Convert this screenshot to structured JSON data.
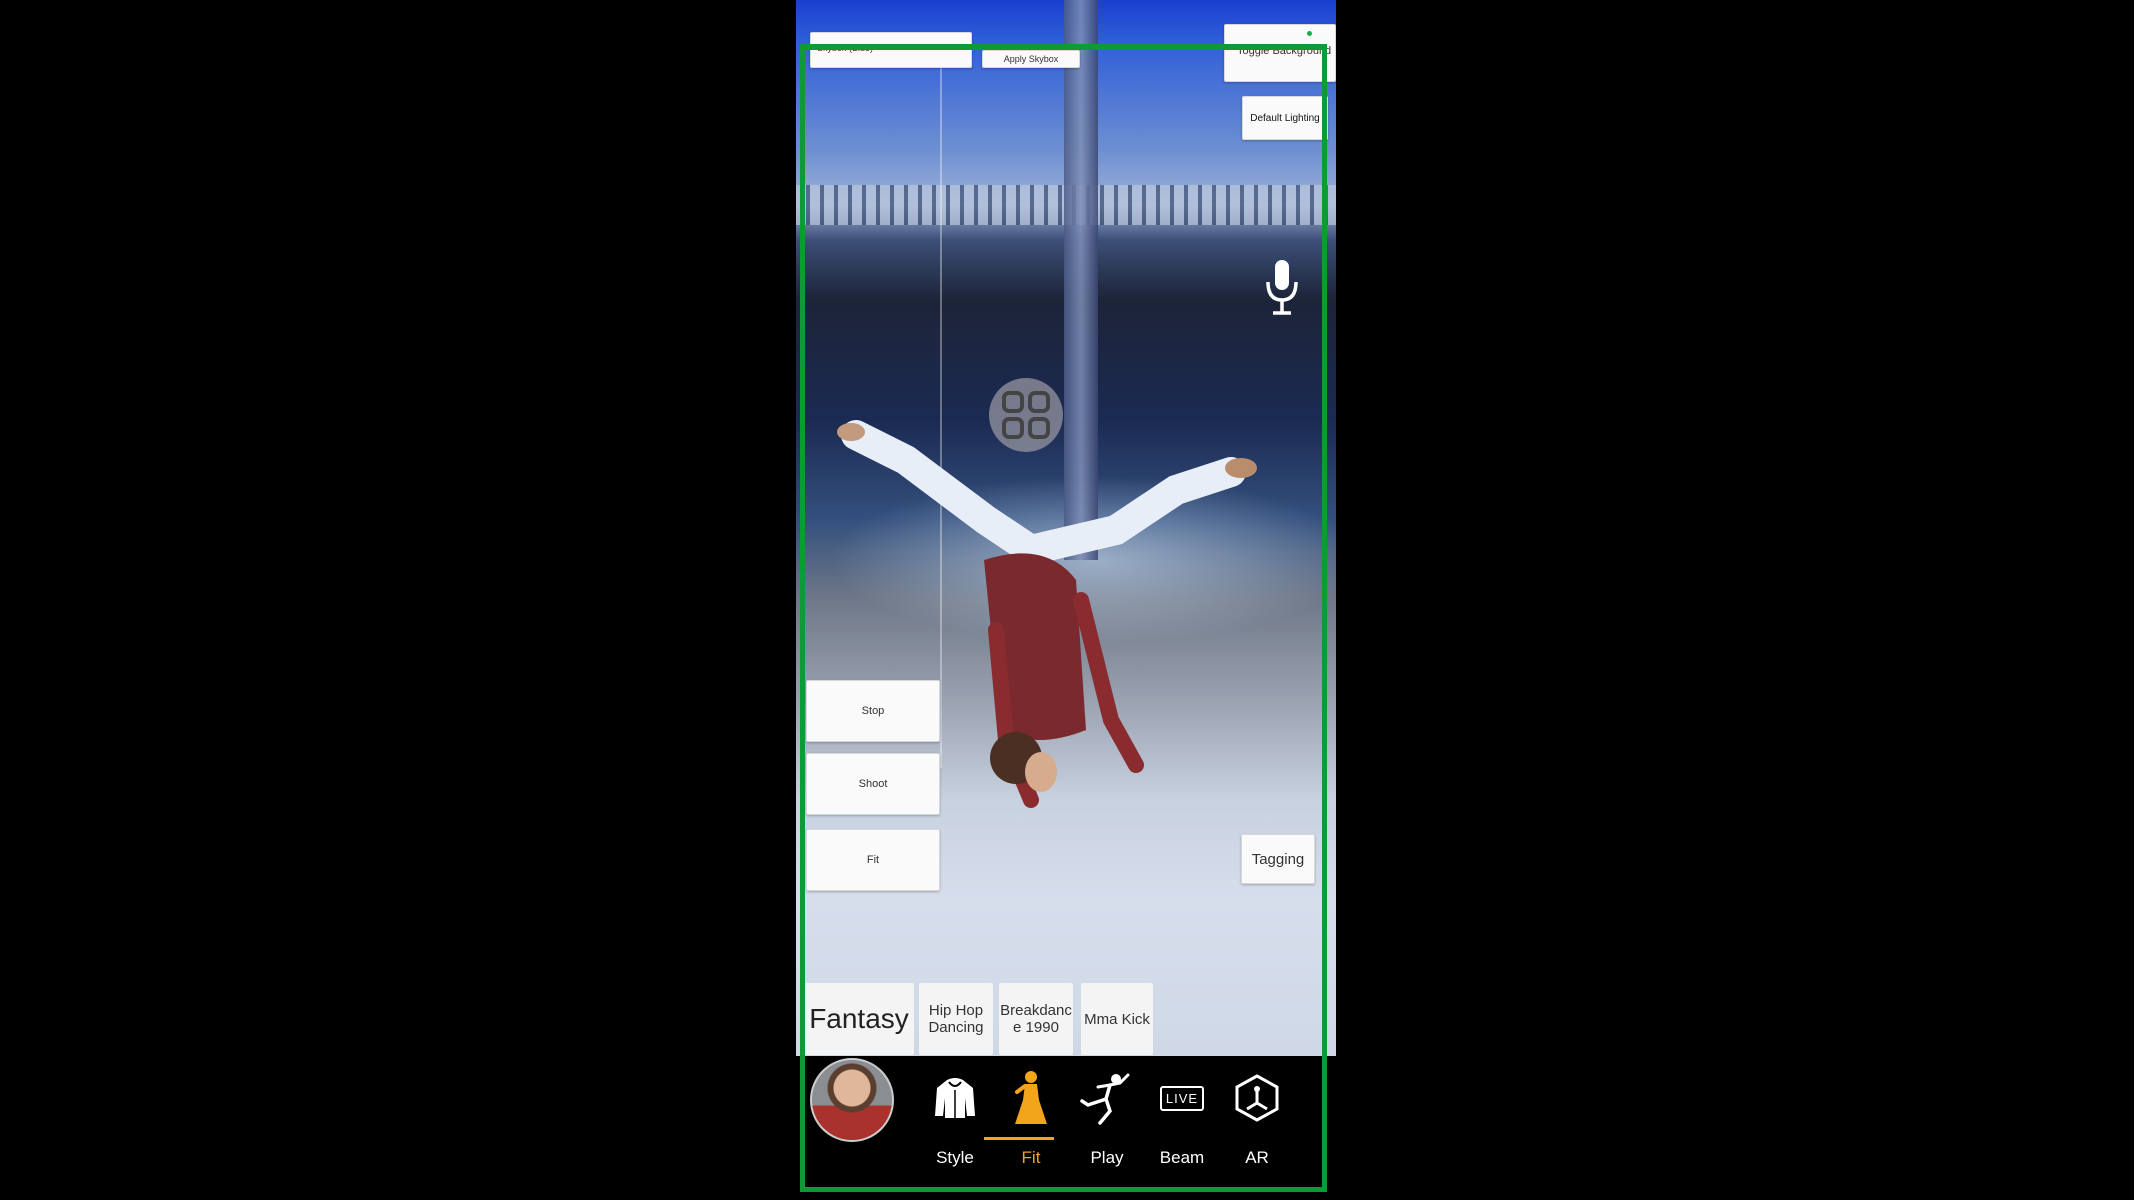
{
  "top_bar": {
    "dropdown_text": "Skybox (Blue)",
    "apply_skybox_label": "Apply Skybox",
    "toggle_background_label": "Toggle Background",
    "default_lighting_label": "Default Lighting"
  },
  "side_buttons": {
    "stop_label": "Stop",
    "shoot_label": "Shoot",
    "fit_label": "Fit",
    "tagging_label": "Tagging"
  },
  "categories": {
    "selected": "Fantasy",
    "items": [
      "Hip Hop Dancing",
      "Breakdance 1990",
      "Mma Kick"
    ]
  },
  "tabs": [
    {
      "label": "Style",
      "icon": "hoodie-icon"
    },
    {
      "label": "Fit",
      "icon": "fit-figure-icon",
      "active": true
    },
    {
      "label": "Play",
      "icon": "dancer-icon"
    },
    {
      "label": "Beam",
      "icon": "live-icon"
    },
    {
      "label": "AR",
      "icon": "ar-cube-icon"
    }
  ],
  "icons": {
    "mic": "microphone-icon",
    "menu": "grid-menu-icon"
  },
  "live_badge": "LIVE",
  "colors": {
    "frame": "#0f9a37",
    "active_tab": "#f2a41a"
  }
}
